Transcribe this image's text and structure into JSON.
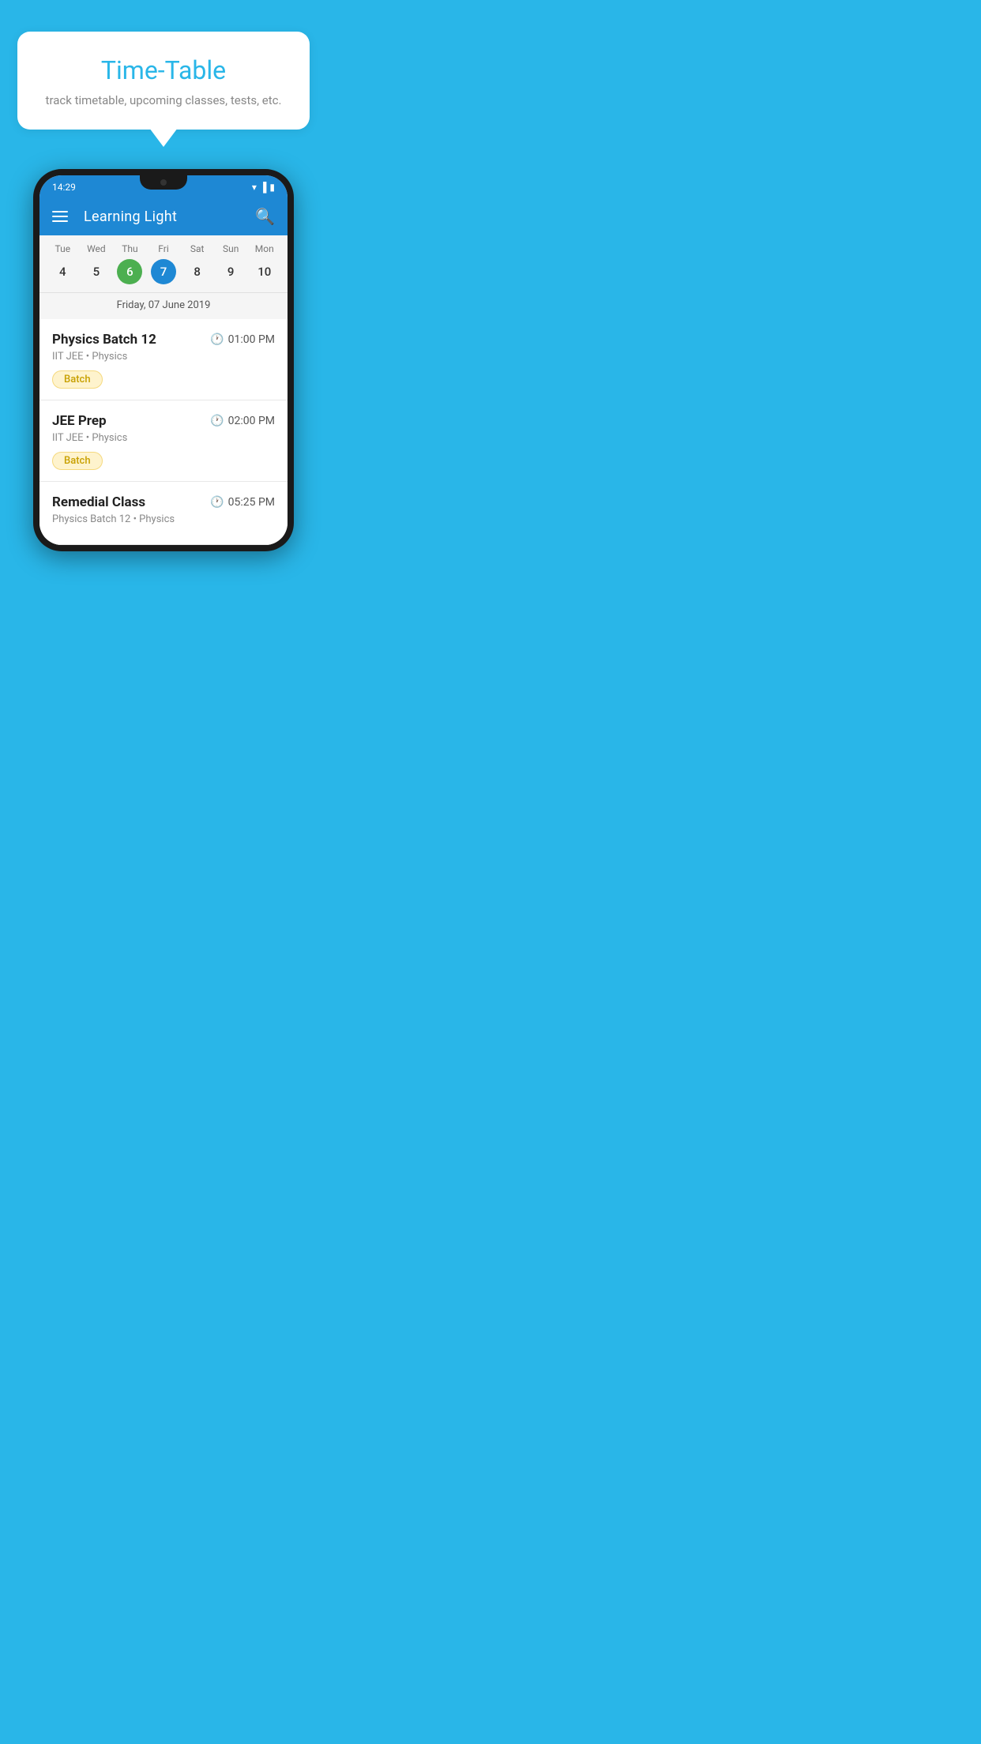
{
  "background": "#29b6e8",
  "bubble": {
    "title": "Time-Table",
    "subtitle": "track timetable, upcoming classes, tests, etc."
  },
  "app": {
    "title": "Learning Light"
  },
  "status_bar": {
    "time": "14:29"
  },
  "calendar": {
    "selected_date_label": "Friday, 07 June 2019",
    "days": [
      {
        "name": "Tue",
        "num": "4",
        "state": "normal"
      },
      {
        "name": "Wed",
        "num": "5",
        "state": "normal"
      },
      {
        "name": "Thu",
        "num": "6",
        "state": "today"
      },
      {
        "name": "Fri",
        "num": "7",
        "state": "selected"
      },
      {
        "name": "Sat",
        "num": "8",
        "state": "normal"
      },
      {
        "name": "Sun",
        "num": "9",
        "state": "normal"
      },
      {
        "name": "Mon",
        "num": "10",
        "state": "normal"
      }
    ]
  },
  "classes": [
    {
      "name": "Physics Batch 12",
      "time": "01:00 PM",
      "subject": "IIT JEE • Physics",
      "badge": "Batch"
    },
    {
      "name": "JEE Prep",
      "time": "02:00 PM",
      "subject": "IIT JEE • Physics",
      "badge": "Batch"
    },
    {
      "name": "Remedial Class",
      "time": "05:25 PM",
      "subject": "Physics Batch 12 • Physics",
      "badge": null
    }
  ],
  "icons": {
    "menu": "hamburger-menu-icon",
    "search": "search-icon",
    "clock": "clock-icon"
  }
}
